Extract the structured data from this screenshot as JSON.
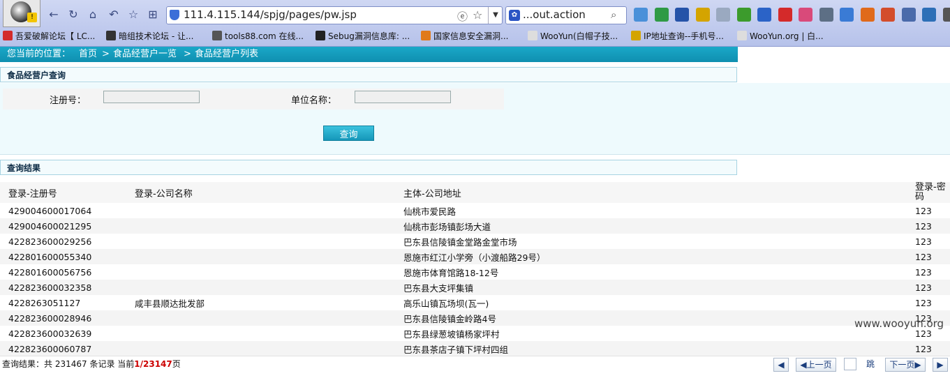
{
  "browser": {
    "url": "111.4.115.144/spjg/pages/pw.jsp",
    "search_text": "...out.action",
    "search_engine_icon": "paw-icon",
    "ext_icons": [
      "#4a90d9",
      "#2f9a45",
      "#2553a8",
      "#d4a400",
      "#9aa9c0",
      "#3c9b2c",
      "#2b63c7",
      "#d42a2a",
      "#d94a7a",
      "#5d6f85",
      "#3a7bd5",
      "#e06a1b",
      "#d34d2b",
      "#4a6aaa",
      "#2d6fb7",
      "#555555"
    ],
    "bookmarks": [
      {
        "label": "吾爱破解论坛【 LC...",
        "color": "#d32b2b"
      },
      {
        "label": "暗组技术论坛 - 让...",
        "color": "#333333"
      },
      {
        "label": "tools88.com 在线...",
        "color": "#555555"
      },
      {
        "label": "Sebug漏洞信息库: ...",
        "color": "#222222"
      },
      {
        "label": "国家信息安全漏洞...",
        "color": "#e07a1a"
      },
      {
        "label": "WooYun(白帽子技...",
        "color": "#dddddd"
      },
      {
        "label": "IP地址查询--手机号...",
        "color": "#d4a400"
      },
      {
        "label": "WooYun.org | 白...",
        "color": "#dddddd"
      }
    ]
  },
  "page": {
    "breadcrumb": {
      "prefix": "您当前的位置：",
      "items": [
        "首页",
        ">",
        "食品经营户一览",
        ">",
        "食品经营户列表"
      ]
    },
    "query_section_title": "食品经营户查询",
    "query": {
      "reg_label": "注册号：",
      "reg_value": "",
      "name_label": "单位名称：",
      "name_value": "",
      "button_label": "查询"
    },
    "results_section_title": "查询结果",
    "table": {
      "headers": [
        "登录-注册号",
        "登录-公司名称",
        "主体-公司地址",
        "登录-密码"
      ],
      "rows": [
        [
          "429004600017064",
          "",
          "仙桃市爱民路",
          "123"
        ],
        [
          "429004600021295",
          "",
          "仙桃市彭场镇彭场大道",
          "123"
        ],
        [
          "422823600029256",
          "",
          "巴东县信陵镇金堂路金堂市场",
          "123"
        ],
        [
          "422801600055340",
          "",
          "恩施市红江小学旁（小渡船路29号）",
          "123"
        ],
        [
          "422801600056756",
          "",
          "恩施市体育馆路18-12号",
          "123"
        ],
        [
          "422823600032358",
          "",
          "巴东县大支坪集镇",
          "123"
        ],
        [
          "4228263051127",
          "咸丰县顺达批发部",
          "高乐山镇瓦场坝(瓦一)",
          "123"
        ],
        [
          "422823600028946",
          "",
          "巴东县信陵镇金岭路4号",
          "123"
        ],
        [
          "422823600032639",
          "",
          "巴东县绿葱坡镇杨家坪村",
          "123"
        ],
        [
          "422823600060787",
          "",
          "巴东县茶店子镇下坪村四组",
          "123"
        ]
      ]
    },
    "pagination": {
      "summary_prefix": "查询结果：共 231467 条记录 当前",
      "current": "1/23147",
      "summary_suffix": "页",
      "prev_label": "上一页",
      "jump_label": "跳",
      "next_label": "下一页"
    },
    "watermark": "www.wooyun.org"
  }
}
